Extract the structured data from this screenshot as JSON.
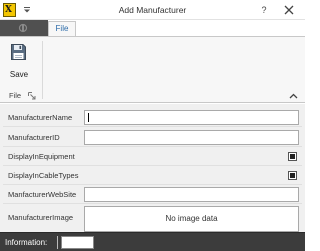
{
  "window": {
    "title": "Add Manufacturer",
    "help_label": "?",
    "app_icon": "xl-app-icon",
    "dropdown_icon": "chevron-down-icon",
    "close_icon": "close-icon"
  },
  "ribbon": {
    "tabs": [
      {
        "label": "File",
        "active": true
      }
    ],
    "backstage_icon": "app-menu-icon",
    "groups": [
      {
        "label": "File",
        "launcher_icon": "dialog-launcher-icon",
        "buttons": [
          {
            "label": "Save",
            "icon": "floppy-disk-icon"
          }
        ]
      }
    ],
    "collapse_icon": "chevron-up-icon"
  },
  "form": {
    "fields": [
      {
        "label": "ManufacturerName",
        "type": "text",
        "value": ""
      },
      {
        "label": "ManufacturerID",
        "type": "text",
        "value": ""
      },
      {
        "label": "DisplayInEquipment",
        "type": "checkbox",
        "checked": true
      },
      {
        "label": "DisplayInCableTypes",
        "type": "checkbox",
        "checked": true
      },
      {
        "label": "ManfacturerWebSite",
        "type": "text",
        "value": ""
      },
      {
        "label": "ManufacturerImage",
        "type": "image",
        "placeholder": "No image data"
      }
    ]
  },
  "statusbar": {
    "label": "Information:",
    "value": ""
  },
  "colors": {
    "titlebar_bg": "#ffffff",
    "backstage_bg": "#505050",
    "tab_text": "#2b6aa8",
    "ribbon_bg": "#f7f7f7",
    "form_bg": "#f0f0f0",
    "statusbar_bg": "#3c3c3c",
    "app_icon_bg": "#f3c600"
  }
}
